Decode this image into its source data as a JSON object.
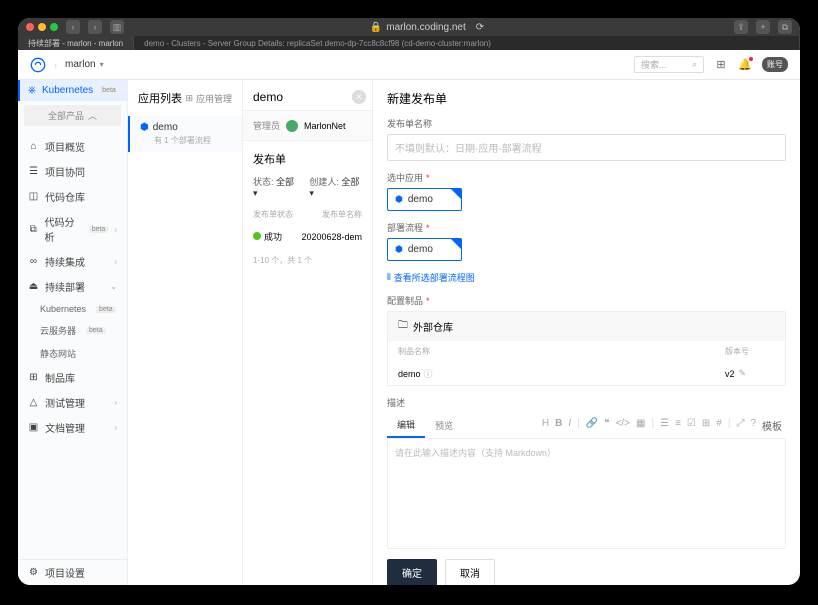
{
  "browser": {
    "url": "marlon.coding.net",
    "tabs": [
      "持续部署 - marlon - marlon",
      "demo - Clusters - Server Group Details: replicaSet demo-dp-7cc8c8cf98 (cd-demo-cluster:marlon)"
    ]
  },
  "header": {
    "project": "marlon",
    "search_placeholder": "搜索...",
    "avatar_label": "账号"
  },
  "sidebar": {
    "product_dropdown": "全部产品",
    "items": {
      "kubernetes": "Kubernetes",
      "overview": "项目概览",
      "collab": "项目协同",
      "repo": "代码仓库",
      "analysis": "代码分析",
      "ci": "持续集成",
      "cd": "持续部署",
      "k8s_sub": "Kubernetes",
      "cloud_server": "云服务器",
      "static_site": "静态网站",
      "artifact": "制品库",
      "test": "测试管理",
      "docs": "文档管理",
      "settings": "项目设置"
    },
    "beta": "beta"
  },
  "app_list": {
    "title": "应用列表",
    "manage_link": "应用管理",
    "item_name": "demo",
    "item_sub": "有 1 个部署流程"
  },
  "detail": {
    "title": "demo",
    "admin_label": "管理员",
    "admin_name": "MarlonNet",
    "section": "发布单",
    "filter_status_label": "状态:",
    "filter_status_value": "全部",
    "filter_creator_label": "创建人:",
    "filter_creator_value": "全部",
    "col_status": "发布单状态",
    "col_name": "发布单名称",
    "row_status": "成功",
    "row_name": "20200628-dem",
    "paging": "1-10 个，共 1 个"
  },
  "panel": {
    "title": "新建发布单",
    "name_label": "发布单名称",
    "name_placeholder": "不填则默认：日期-应用-部署流程",
    "app_label": "选中应用",
    "app_value": "demo",
    "pipeline_label": "部署流程",
    "pipeline_value": "demo",
    "view_pipeline": "查看所选部署流程图",
    "artifact_label": "配置制品",
    "artifact_repo": "外部仓库",
    "artifact_col_name": "制品名称",
    "artifact_col_ver": "版本号",
    "artifact_name": "demo",
    "artifact_ver": "v2",
    "desc_label": "描述",
    "tab_edit": "编辑",
    "tab_preview": "预览",
    "tpl_label": "模板",
    "desc_placeholder": "请在此输入描述内容（支持 Markdown）",
    "btn_ok": "确定",
    "btn_cancel": "取消"
  }
}
